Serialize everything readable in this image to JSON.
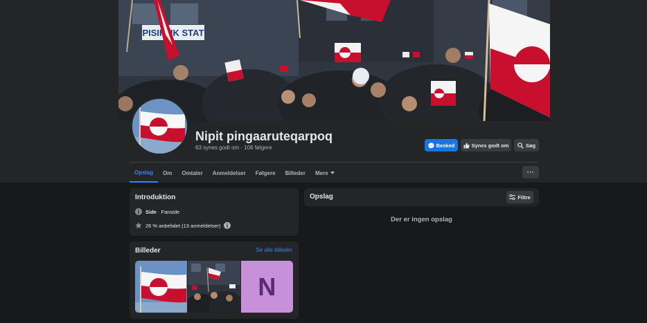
{
  "cover": {
    "sign_text": "PISIFFIK STAT"
  },
  "page": {
    "name": "Nipit pingaaruteqarpoq",
    "stats": "63 synes godt om · 106 følgere"
  },
  "actions": {
    "message_label": "Besked",
    "like_label": "Synes godt om",
    "search_label": "Søg",
    "more_label": "···"
  },
  "tabs": [
    {
      "label": "Opslag",
      "active": true
    },
    {
      "label": "Om"
    },
    {
      "label": "Omtaler"
    },
    {
      "label": "Anmeldelser"
    },
    {
      "label": "Følgere"
    },
    {
      "label": "Billeder"
    },
    {
      "label": "Mere",
      "dropdown": true
    }
  ],
  "intro": {
    "title": "Introduktion",
    "category_strong": "Side",
    "category_rest": " · Fanside",
    "rating": "26 % anbefalet (13 anmeldelser)"
  },
  "photos": {
    "title": "Billeder",
    "see_all": "Se alle billeder",
    "third_thumb_letter": "N"
  },
  "posts": {
    "title": "Opslag",
    "filter_label": "Filtre",
    "empty_text": "Der er ingen opslag"
  },
  "colors": {
    "accent": "#2d88ff",
    "message_button": "#1b74e4",
    "flag_red": "#c8102e",
    "background": "#18191a",
    "surface": "#242526"
  }
}
